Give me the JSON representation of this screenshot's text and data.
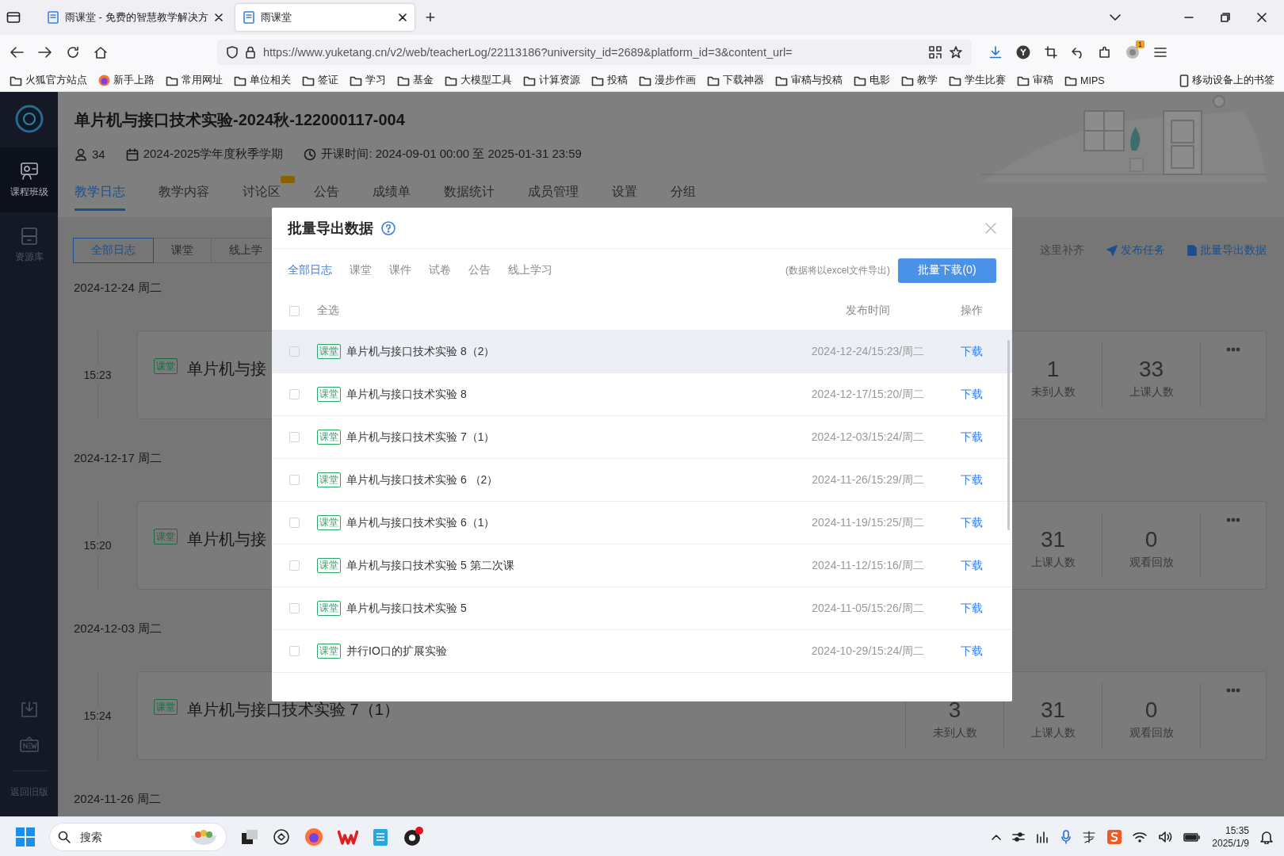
{
  "browser": {
    "tabs": [
      {
        "title": "雨课堂 - 免费的智慧教学解决方",
        "selected": false
      },
      {
        "title": "雨课堂",
        "selected": true
      }
    ],
    "new_tab": "+",
    "url": "https://www.yuketang.cn/v2/web/teacherLog/22113186?university_id=2689&platform_id=3&content_url=",
    "extension_badge": "1",
    "bookmarks": [
      {
        "label": "火狐官方站点",
        "kind": "folder"
      },
      {
        "label": "新手上路",
        "kind": "site"
      },
      {
        "label": "常用网址",
        "kind": "folder"
      },
      {
        "label": "单位相关",
        "kind": "folder"
      },
      {
        "label": "签证",
        "kind": "folder"
      },
      {
        "label": "学习",
        "kind": "folder"
      },
      {
        "label": "基金",
        "kind": "folder"
      },
      {
        "label": "大模型工具",
        "kind": "folder"
      },
      {
        "label": "计算资源",
        "kind": "folder"
      },
      {
        "label": "投稿",
        "kind": "folder"
      },
      {
        "label": "漫步作画",
        "kind": "folder"
      },
      {
        "label": "下载神器",
        "kind": "folder"
      },
      {
        "label": "审稿与投稿",
        "kind": "folder"
      },
      {
        "label": "电影",
        "kind": "folder"
      },
      {
        "label": "教学",
        "kind": "folder"
      },
      {
        "label": "学生比赛",
        "kind": "folder"
      },
      {
        "label": "审稿",
        "kind": "folder"
      },
      {
        "label": "MIPS",
        "kind": "folder"
      }
    ],
    "mobile_bookmarks": "移动设备上的书签"
  },
  "sidebar": {
    "items": [
      {
        "label": "课程班级",
        "selected": true
      },
      {
        "label": "资源库",
        "selected": false
      }
    ],
    "footer": "返回旧版"
  },
  "course": {
    "title": "单片机与接口技术实验-2024秋-122000117-004",
    "students": "34",
    "term": "2024-2025学年度秋季学期",
    "schedule": "开课时间: 2024-09-01 00:00 至 2025-01-31 23:59"
  },
  "nav_tabs": [
    {
      "label": "教学日志",
      "selected": true,
      "new_badge": false
    },
    {
      "label": "教学内容",
      "selected": false,
      "new_badge": false
    },
    {
      "label": "讨论区",
      "selected": false,
      "new_badge": true
    },
    {
      "label": "公告",
      "selected": false,
      "new_badge": false
    },
    {
      "label": "成绩单",
      "selected": false,
      "new_badge": false
    },
    {
      "label": "数据统计",
      "selected": false,
      "new_badge": false
    },
    {
      "label": "成员管理",
      "selected": false,
      "new_badge": false
    },
    {
      "label": "设置",
      "selected": false,
      "new_badge": false
    },
    {
      "label": "分组",
      "selected": false,
      "new_badge": false
    }
  ],
  "filters": [
    {
      "label": "全部日志",
      "selected": true
    },
    {
      "label": "课堂",
      "selected": false
    },
    {
      "label": "线上学",
      "selected": false
    }
  ],
  "actions": {
    "hint": "这里补齐",
    "publish": "发布任务",
    "export": "批量导出数据"
  },
  "log": [
    {
      "date": "2024-12-24 周二",
      "entries": [
        {
          "time": "15:23",
          "tag": "课堂",
          "title": "单片机与接",
          "stats": [
            {
              "value": "1",
              "label": "未到人数"
            },
            {
              "value": "33",
              "label": "上课人数"
            }
          ]
        }
      ]
    },
    {
      "date": "2024-12-17 周二",
      "entries": [
        {
          "time": "15:20",
          "tag": "课堂",
          "title": "单片机与接",
          "stats": [
            {
              "value": "31",
              "label": "上课人数"
            },
            {
              "value": "0",
              "label": "观看回放"
            }
          ]
        }
      ]
    },
    {
      "date": "2024-12-03 周二",
      "entries": [
        {
          "time": "15:24",
          "tag": "课堂",
          "title": "单片机与接口技术实验 7（1）",
          "stats": [
            {
              "value": "3",
              "label": "未到人数"
            },
            {
              "value": "31",
              "label": "上课人数"
            },
            {
              "value": "0",
              "label": "观看回放"
            }
          ]
        }
      ]
    },
    {
      "date": "2024-11-26 周二"
    }
  ],
  "modal": {
    "title": "批量导出数据",
    "tabs": [
      {
        "label": "全部日志",
        "selected": true
      },
      {
        "label": "课堂",
        "selected": false
      },
      {
        "label": "课件",
        "selected": false
      },
      {
        "label": "试卷",
        "selected": false
      },
      {
        "label": "公告",
        "selected": false
      },
      {
        "label": "线上学习",
        "selected": false
      }
    ],
    "note": "(数据将以excel文件导出)",
    "download_all": "批量下载(0)",
    "select_all": "全选",
    "select_all_checked": false,
    "columns": [
      "发布时间",
      "操作"
    ],
    "rows": [
      {
        "tag": "课堂",
        "title": "单片机与接口技术实验 8（2）",
        "time": "2024-12-24/15:23/周二",
        "action": "下载",
        "checked": false,
        "hovered": true
      },
      {
        "tag": "课堂",
        "title": "单片机与接口技术实验 8",
        "time": "2024-12-17/15:20/周二",
        "action": "下载",
        "checked": false,
        "hovered": false
      },
      {
        "tag": "课堂",
        "title": "单片机与接口技术实验 7（1）",
        "time": "2024-12-03/15:24/周二",
        "action": "下载",
        "checked": false,
        "hovered": false
      },
      {
        "tag": "课堂",
        "title": "单片机与接口技术实验 6 （2）",
        "time": "2024-11-26/15:29/周二",
        "action": "下载",
        "checked": false,
        "hovered": false
      },
      {
        "tag": "课堂",
        "title": "单片机与接口技术实验 6（1）",
        "time": "2024-11-19/15:25/周二",
        "action": "下载",
        "checked": false,
        "hovered": false
      },
      {
        "tag": "课堂",
        "title": "单片机与接口技术实验 5 第二次课",
        "time": "2024-11-12/15:16/周二",
        "action": "下载",
        "checked": false,
        "hovered": false
      },
      {
        "tag": "课堂",
        "title": "单片机与接口技术实验 5",
        "time": "2024-11-05/15:26/周二",
        "action": "下载",
        "checked": false,
        "hovered": false
      },
      {
        "tag": "课堂",
        "title": "并行IO口的扩展实验",
        "time": "2024-10-29/15:24/周二",
        "action": "下载",
        "checked": false,
        "hovered": false
      }
    ]
  },
  "taskbar": {
    "search_placeholder": "搜索",
    "time": "15:35",
    "date": "2025/1/9"
  }
}
